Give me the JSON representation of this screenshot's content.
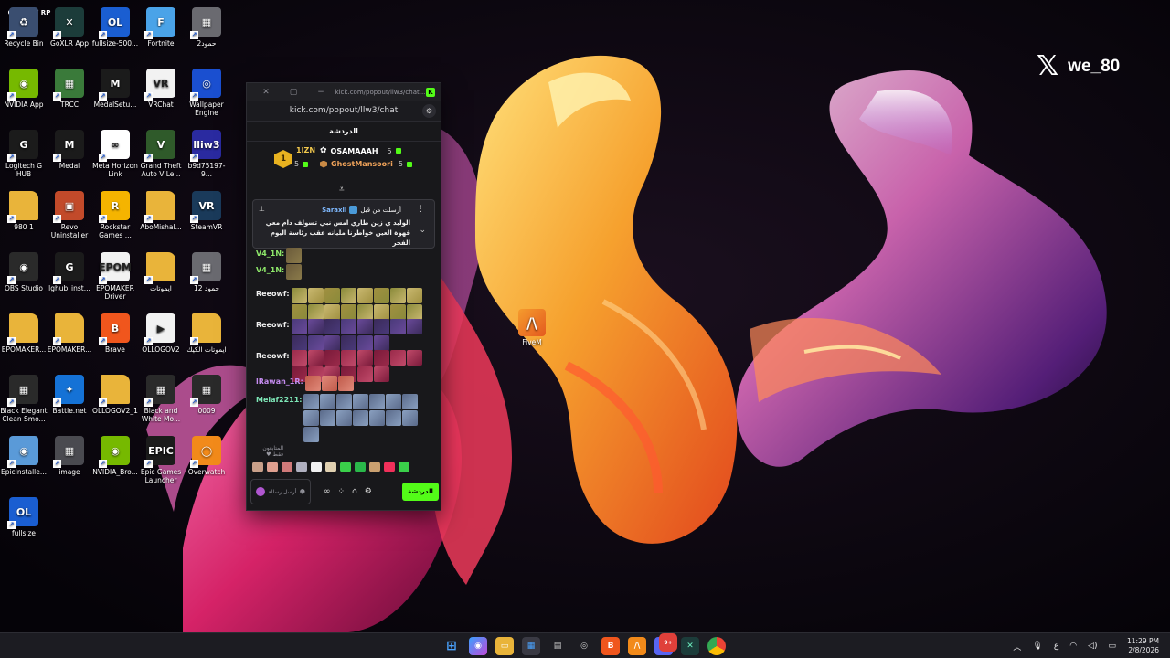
{
  "watermark": {
    "x_glyph": "𝕏",
    "handle": "we_80"
  },
  "outlaw": "OUTLAW RP",
  "desktop_icons": [
    {
      "label": "Recycle Bin",
      "glyph": "♻",
      "bg": "#3a4e70"
    },
    {
      "label": "GoXLR App",
      "glyph": "✕",
      "bg": "#1c3c3a"
    },
    {
      "label": "fullsize-500...",
      "glyph": "OL",
      "bg": "#1a5ed1"
    },
    {
      "label": "Fortnite",
      "glyph": "F",
      "bg": "#4aa3e8"
    },
    {
      "label": "حمود2",
      "glyph": "▦",
      "bg": "#6a6a70"
    },
    {
      "label": "NVIDIA App",
      "glyph": "◉",
      "bg": "#76b900"
    },
    {
      "label": "TRCC",
      "glyph": "▦",
      "bg": "#3a7a3a"
    },
    {
      "label": "MedalSetu...",
      "glyph": "M",
      "bg": "#1b1b1b"
    },
    {
      "label": "VRChat",
      "glyph": "VR",
      "bg": "#f2f2f2"
    },
    {
      "label": "Wallpaper Engine",
      "glyph": "◎",
      "bg": "#1a4fd0"
    },
    {
      "label": "Logitech G HUB",
      "glyph": "G",
      "bg": "#1b1b1b"
    },
    {
      "label": "Medal",
      "glyph": "M",
      "bg": "#1b1b1b"
    },
    {
      "label": "Meta Horizon Link",
      "glyph": "∞",
      "bg": "#ffffff"
    },
    {
      "label": "Grand Theft Auto V Le...",
      "glyph": "V",
      "bg": "#2f5a2a"
    },
    {
      "label": "b9d75197-9...",
      "glyph": "lliw3",
      "bg": "#2a2aa0"
    },
    {
      "label": "980 1",
      "glyph": "",
      "bg": "#e9b43a"
    },
    {
      "label": "Revo Uninstaller",
      "glyph": "▣",
      "bg": "#c24a2a"
    },
    {
      "label": "Rockstar Games ...",
      "glyph": "R",
      "bg": "#f5b400"
    },
    {
      "label": "AboMishal...",
      "glyph": "",
      "bg": "#e9b43a"
    },
    {
      "label": "SteamVR",
      "glyph": "VR",
      "bg": "#1a3a5a"
    },
    {
      "label": "OBS Studio",
      "glyph": "◉",
      "bg": "#2a2a2a"
    },
    {
      "label": "lghub_inst...",
      "glyph": "G",
      "bg": "#1b1b1b"
    },
    {
      "label": "EPOMAKER Driver",
      "glyph": "EPOM",
      "bg": "#f2f2f2"
    },
    {
      "label": "ايموتات",
      "glyph": "",
      "bg": "#e9b43a"
    },
    {
      "label": "حمود 12",
      "glyph": "▦",
      "bg": "#6a6a70"
    },
    {
      "label": "EPOMAKER...",
      "glyph": "",
      "bg": "#e9b43a"
    },
    {
      "label": "EPOMAKER...",
      "glyph": "",
      "bg": "#e9b43a"
    },
    {
      "label": "Brave",
      "glyph": "B",
      "bg": "#f0561d"
    },
    {
      "label": "OLLOGOV2",
      "glyph": "▶",
      "bg": "#f2f2f2"
    },
    {
      "label": "ايموتات الكيك",
      "glyph": "",
      "bg": "#e9b43a"
    },
    {
      "label": "Black Elegant Clean Smo...",
      "glyph": "▦",
      "bg": "#2a2a2a"
    },
    {
      "label": "Battle.net",
      "glyph": "✦",
      "bg": "#1572d6"
    },
    {
      "label": "OLLOGOV2_1",
      "glyph": "",
      "bg": "#e9b43a"
    },
    {
      "label": "Black and White Mo...",
      "glyph": "▦",
      "bg": "#2a2a2a"
    },
    {
      "label": "0009",
      "glyph": "▦",
      "bg": "#2a2a2a"
    },
    {
      "label": "EpicInstalle...",
      "glyph": "◉",
      "bg": "#5a9ad8"
    },
    {
      "label": "image",
      "glyph": "▦",
      "bg": "#4a4a50"
    },
    {
      "label": "NVIDIA_Bro...",
      "glyph": "◉",
      "bg": "#76b900"
    },
    {
      "label": "Epic Games Launcher",
      "glyph": "EPIC",
      "bg": "#1b1b1b"
    },
    {
      "label": "Overwatch",
      "glyph": "◯",
      "bg": "#f28a1a"
    },
    {
      "label": "fullsize",
      "glyph": "OL",
      "bg": "#1a5ed1"
    }
  ],
  "fivem": {
    "label": "FiveM",
    "glyph": "/\\"
  },
  "popup": {
    "title_url": "kick.com/popout/llw3/chat...",
    "address": "kick.com/popout/llw3/chat",
    "header": "الدردشة",
    "leader_rank": "1",
    "top": [
      {
        "name": "1IZN",
        "count": "5"
      },
      {
        "name": "OSAMAAAH",
        "count": "5"
      },
      {
        "name": "GhostMansoori",
        "count": "5"
      }
    ],
    "pinned": {
      "by_label": "أرسلت من قبل",
      "by_user": "Saraxll",
      "message": "الوليد ي زين طاري امس نبي تسولف دام معي قهوة العين خواطرنا مليانه عقب رئاسة اليوم الفجر"
    },
    "messages": [
      {
        "user": "V4_1N:",
        "color": "#8ee86a",
        "emotes": 1
      },
      {
        "user": "V4_1N:",
        "color": "#8ee86a",
        "emotes": 1
      },
      {
        "user": "Reeowf:",
        "color": "#f0f0f0",
        "emotes": 16
      },
      {
        "user": "Reeowf:",
        "color": "#f0f0f0",
        "emotes": 14
      },
      {
        "user": "Reeowf:",
        "color": "#f0f0f0",
        "emotes": 14
      },
      {
        "user": "lRawan_1R:",
        "color": "#c58cf0",
        "emotes": 3
      },
      {
        "user": "Melaf2211:",
        "color": "#7ee8b8",
        "emotes": 15
      }
    ],
    "emote_bar_title": "المتابعون فقط",
    "input_placeholder": "أرسل رسالة",
    "send_label": "الدردشة"
  },
  "taskbar": {
    "keyboard_lang": "ع",
    "time": "11:29 PM",
    "date": "2/8/2026",
    "discord_badge": "9+"
  }
}
